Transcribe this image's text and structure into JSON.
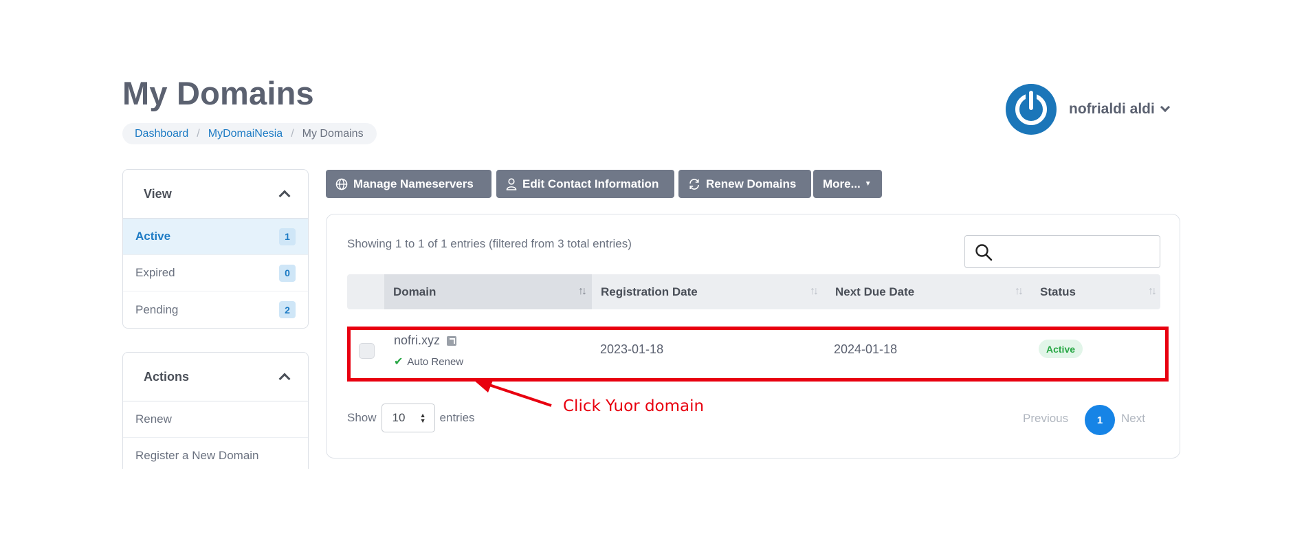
{
  "page": {
    "title": "My Domains"
  },
  "breadcrumb": {
    "items": [
      {
        "label": "Dashboard"
      },
      {
        "label": "MyDomaiNesia"
      },
      {
        "label": "My Domains"
      }
    ]
  },
  "user": {
    "name": "nofrialdi aldi"
  },
  "view_panel": {
    "title": "View",
    "items": [
      {
        "label": "Active",
        "count": "1",
        "selected": true
      },
      {
        "label": "Expired",
        "count": "0"
      },
      {
        "label": "Pending",
        "count": "2"
      }
    ]
  },
  "actions_panel": {
    "title": "Actions",
    "items": [
      {
        "label": "Renew"
      },
      {
        "label": "Register a New Domain"
      }
    ]
  },
  "toolbar": {
    "manage_ns": "Manage Nameservers",
    "edit_contact": "Edit Contact Information",
    "renew": "Renew Domains",
    "more": "More..."
  },
  "table": {
    "info": "Showing 1 to 1 of 1 entries (filtered from 3 total entries)",
    "columns": [
      "Domain",
      "Registration Date",
      "Next Due Date",
      "Status"
    ],
    "rows": [
      {
        "domain": "nofri.xyz",
        "auto_renew": "Auto Renew",
        "registration_date": "2023-01-18",
        "next_due_date": "2024-01-18",
        "status": "Active"
      }
    ],
    "length": {
      "show": "Show",
      "value": "10",
      "suffix": "entries"
    },
    "pagination": {
      "previous": "Previous",
      "current": "1",
      "next": "Next"
    }
  },
  "annotation": {
    "text": "Click Yuor domain",
    "color": "#e8000f"
  },
  "colors": {
    "accent": "#1d7bc4",
    "button": "#707888",
    "status_active": "#28a745"
  }
}
